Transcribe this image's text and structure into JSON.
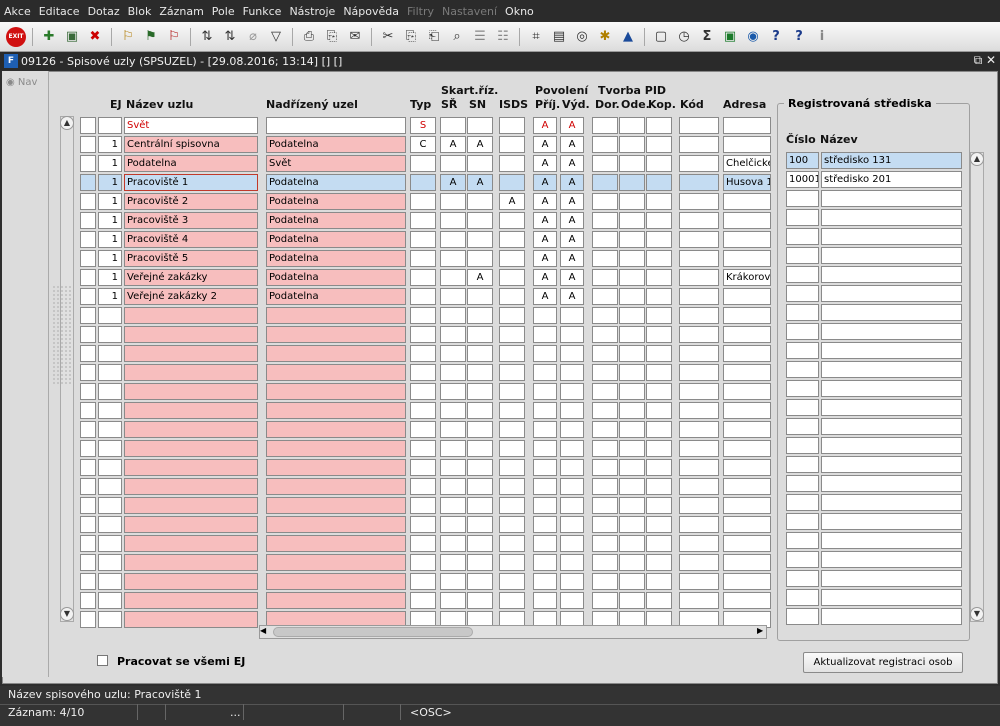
{
  "menu": [
    "Akce",
    "Editace",
    "Dotaz",
    "Blok",
    "Záznam",
    "Pole",
    "Funkce",
    "Nástroje",
    "Nápověda",
    "Filtry",
    "Nastavení",
    "Okno"
  ],
  "menu_disabled": [
    "Filtry",
    "Nastavení"
  ],
  "toolbar": {
    "exit_label": "EXIT"
  },
  "window": {
    "title": "09126 - Spisové uzly (SPSUZEL) - [29.08.2016; 13:14] [] []",
    "logo": "F"
  },
  "nav_label": "Nav",
  "headers": {
    "ej": "EJ",
    "nazev": "Název uzlu",
    "nadrizeny": "Nadřízený uzel",
    "typ": "Typ",
    "skart_group": "Skart.říz.",
    "sr": "SŘ",
    "sn": "SN",
    "isds": "ISDS",
    "povoleni_group": "Povolení",
    "prij": "Příj.",
    "vyd": "Výd.",
    "tvorba_group": "Tvorba PID",
    "dor": "Dor.",
    "ode": "Ode.",
    "kop": "Kop.",
    "kod": "Kód",
    "adresa": "Adresa"
  },
  "filter_row": {
    "nazev": "Svět",
    "typ": "S",
    "prij": "A",
    "vyd": "A"
  },
  "rows": [
    {
      "ej": "1",
      "nazev": "Centrální spisovna",
      "nadrizeny": "Podatelna",
      "typ": "C",
      "sr": "A",
      "sn": "A",
      "isds": "",
      "prij": "A",
      "vyd": "A",
      "adresa": ""
    },
    {
      "ej": "1",
      "nazev": "Podatelna",
      "nadrizeny": "Svět",
      "typ": "",
      "sr": "",
      "sn": "",
      "isds": "",
      "prij": "A",
      "vyd": "A",
      "adresa": "Chelčického"
    },
    {
      "ej": "1",
      "nazev": "Pracoviště 1",
      "nadrizeny": "Podatelna",
      "typ": "",
      "sr": "A",
      "sn": "A",
      "isds": "",
      "prij": "A",
      "vyd": "A",
      "adresa": "Husova 1"
    },
    {
      "ej": "1",
      "nazev": "Pracoviště 2",
      "nadrizeny": "Podatelna",
      "typ": "",
      "sr": "",
      "sn": "",
      "isds": "A",
      "prij": "A",
      "vyd": "A",
      "adresa": ""
    },
    {
      "ej": "1",
      "nazev": "Pracoviště 3",
      "nadrizeny": "Podatelna",
      "typ": "",
      "sr": "",
      "sn": "",
      "isds": "",
      "prij": "A",
      "vyd": "A",
      "adresa": ""
    },
    {
      "ej": "1",
      "nazev": "Pracoviště 4",
      "nadrizeny": "Podatelna",
      "typ": "",
      "sr": "",
      "sn": "",
      "isds": "",
      "prij": "A",
      "vyd": "A",
      "adresa": ""
    },
    {
      "ej": "1",
      "nazev": "Pracoviště 5",
      "nadrizeny": "Podatelna",
      "typ": "",
      "sr": "",
      "sn": "",
      "isds": "",
      "prij": "A",
      "vyd": "A",
      "adresa": ""
    },
    {
      "ej": "1",
      "nazev": "Veřejné zakázky",
      "nadrizeny": "Podatelna",
      "typ": "",
      "sr": "",
      "sn": "A",
      "isds": "",
      "prij": "A",
      "vyd": "A",
      "adresa": "Krákorova"
    },
    {
      "ej": "1",
      "nazev": "Veřejné zakázky 2",
      "nadrizeny": "Podatelna",
      "typ": "",
      "sr": "",
      "sn": "",
      "isds": "",
      "prij": "A",
      "vyd": "A",
      "adresa": ""
    }
  ],
  "selected_row_index": 2,
  "right_panel": {
    "title": "Registrovaná střediska",
    "col_cislo": "Číslo",
    "col_nazev": "Název",
    "rows": [
      {
        "cislo": "100",
        "nazev": "středisko 131"
      },
      {
        "cislo": "10001",
        "nazev": "středisko 201"
      }
    ]
  },
  "checkbox_label": "Pracovat se všemi EJ",
  "update_button": "Aktualizovat registraci osob",
  "status": {
    "hint": "Název spisového uzlu: Pracoviště 1",
    "record": "Záznam: 4/10",
    "ellipsis": "...",
    "osc": "<OSC>"
  },
  "colors": {
    "pink": "#f7bebe",
    "selected": "#c4dcf2",
    "red": "#d00000"
  }
}
